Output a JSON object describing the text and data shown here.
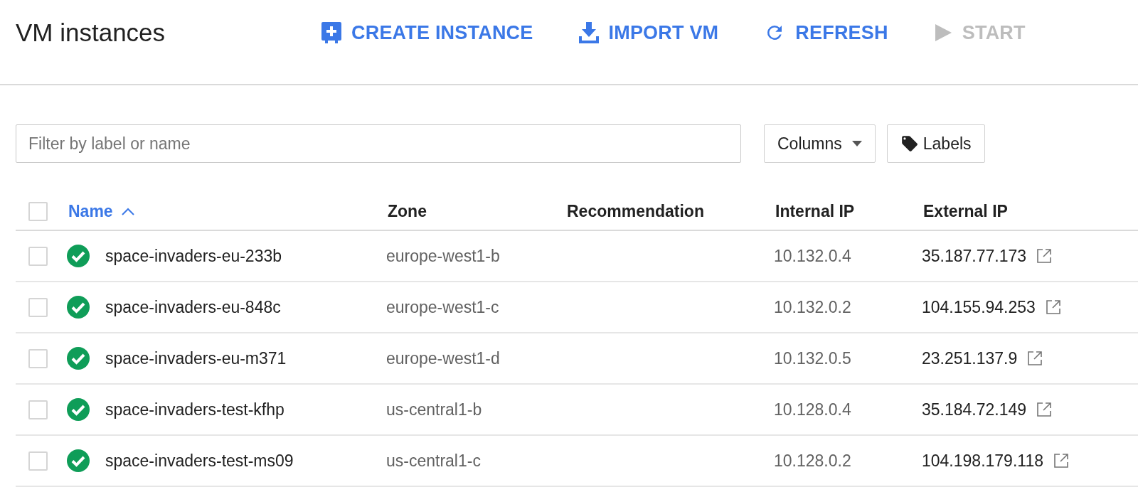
{
  "title": "VM instances",
  "actions": [
    {
      "label": "CREATE INSTANCE",
      "kind": "create",
      "disabled": false
    },
    {
      "label": "IMPORT VM",
      "kind": "import",
      "disabled": false
    },
    {
      "label": "REFRESH",
      "kind": "refresh",
      "disabled": false
    },
    {
      "label": "START",
      "kind": "start",
      "disabled": true
    }
  ],
  "filter": {
    "placeholder": "Filter by label or name"
  },
  "columns_button": {
    "label": "Columns"
  },
  "labels_button": {
    "label": "Labels"
  },
  "table": {
    "select_all_checked": false,
    "columns": [
      {
        "label": "Name",
        "sorted": true
      },
      {
        "label": "Zone",
        "sorted": false
      },
      {
        "label": "Recommendation",
        "sorted": false
      },
      {
        "label": "Internal IP",
        "sorted": false
      },
      {
        "label": "External IP",
        "sorted": false
      }
    ],
    "rows": [
      {
        "checked": false,
        "kind": "running",
        "name": "space-invaders-eu-233b",
        "zone": "europe-west1-b",
        "internal_ip": "10.132.0.4",
        "external_ip": "35.187.77.173"
      },
      {
        "checked": false,
        "kind": "running",
        "name": "space-invaders-eu-848c",
        "zone": "europe-west1-c",
        "internal_ip": "10.132.0.2",
        "external_ip": "104.155.94.253"
      },
      {
        "checked": false,
        "kind": "running",
        "name": "space-invaders-eu-m371",
        "zone": "europe-west1-d",
        "internal_ip": "10.132.0.5",
        "external_ip": "23.251.137.9"
      },
      {
        "checked": false,
        "kind": "running",
        "name": "space-invaders-test-kfhp",
        "zone": "us-central1-b",
        "internal_ip": "10.128.0.4",
        "external_ip": "35.184.72.149"
      },
      {
        "checked": false,
        "kind": "running",
        "name": "space-invaders-test-ms09",
        "zone": "us-central1-c",
        "internal_ip": "10.128.0.2",
        "external_ip": "104.198.179.118"
      }
    ]
  }
}
